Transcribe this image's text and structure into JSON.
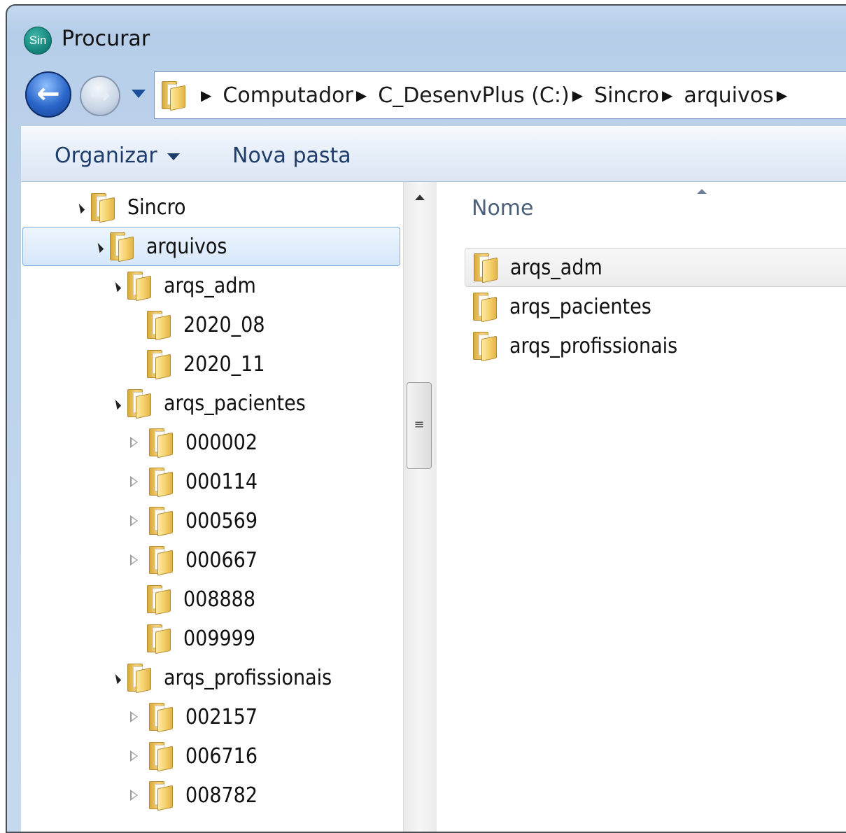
{
  "window": {
    "app_icon_text": "Sin",
    "title": "Procurar"
  },
  "navigation": {
    "back_icon": "arrow-left-icon",
    "forward_icon": "arrow-right-icon",
    "breadcrumbs": [
      "Computador",
      "C_DesenvPlus (C:)",
      "Sincro",
      "arquivos"
    ]
  },
  "toolbar": {
    "organizar_label": "Organizar",
    "nova_pasta_label": "Nova pasta"
  },
  "tree": [
    {
      "label": "Sincro",
      "level": 0,
      "expander": "open",
      "selected": false
    },
    {
      "label": "arquivos",
      "level": 1,
      "expander": "open",
      "selected": true
    },
    {
      "label": "arqs_adm",
      "level": 2,
      "expander": "open",
      "selected": false
    },
    {
      "label": "2020_08",
      "level": 3,
      "expander": "none",
      "selected": false
    },
    {
      "label": "2020_11",
      "level": 3,
      "expander": "none",
      "selected": false
    },
    {
      "label": "arqs_pacientes",
      "level": 2,
      "expander": "open",
      "selected": false
    },
    {
      "label": "000002",
      "level": 3,
      "expander": "closed",
      "selected": false
    },
    {
      "label": "000114",
      "level": 3,
      "expander": "closed",
      "selected": false
    },
    {
      "label": "000569",
      "level": 3,
      "expander": "closed",
      "selected": false
    },
    {
      "label": "000667",
      "level": 3,
      "expander": "closed",
      "selected": false
    },
    {
      "label": "008888",
      "level": 3,
      "expander": "none",
      "selected": false
    },
    {
      "label": "009999",
      "level": 3,
      "expander": "none",
      "selected": false
    },
    {
      "label": "arqs_profissionais",
      "level": 2,
      "expander": "open",
      "selected": false
    },
    {
      "label": "002157",
      "level": 3,
      "expander": "closed",
      "selected": false
    },
    {
      "label": "006716",
      "level": 3,
      "expander": "closed",
      "selected": false
    },
    {
      "label": "008782",
      "level": 3,
      "expander": "closed",
      "selected": false
    }
  ],
  "content": {
    "column_header": "Nome",
    "items": [
      {
        "label": "arqs_adm",
        "hover": true
      },
      {
        "label": "arqs_pacientes",
        "hover": false
      },
      {
        "label": "arqs_profissionais",
        "hover": false
      }
    ]
  }
}
